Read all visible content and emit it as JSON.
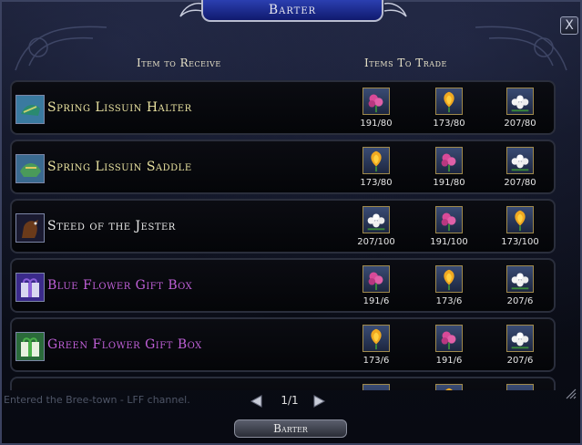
{
  "window": {
    "title": "Barter",
    "close_glyph": "X"
  },
  "columns": {
    "receive": "Item to Receive",
    "trade": "Items To Trade"
  },
  "rows": [
    {
      "name": "Spring Lissuin Halter",
      "name_color": "yellow",
      "icon": "halter-icon",
      "trade": [
        {
          "icon": "pink-flower-icon",
          "count": "191/80"
        },
        {
          "icon": "yellow-flower-icon",
          "count": "173/80"
        },
        {
          "icon": "white-flower-icon",
          "count": "207/80"
        }
      ]
    },
    {
      "name": "Spring Lissuin Saddle",
      "name_color": "yellow",
      "icon": "saddle-icon",
      "trade": [
        {
          "icon": "yellow-flower-icon",
          "count": "173/80"
        },
        {
          "icon": "pink-flower-icon",
          "count": "191/80"
        },
        {
          "icon": "white-flower-icon",
          "count": "207/80"
        }
      ]
    },
    {
      "name": "Steed of the Jester",
      "name_color": "white",
      "icon": "steed-icon",
      "trade": [
        {
          "icon": "white-flower-icon",
          "count": "207/100"
        },
        {
          "icon": "pink-flower-icon",
          "count": "191/100"
        },
        {
          "icon": "yellow-flower-icon",
          "count": "173/100"
        }
      ]
    },
    {
      "name": "Blue Flower Gift Box",
      "name_color": "purple",
      "icon": "blue-gift-box-icon",
      "trade": [
        {
          "icon": "pink-flower-icon",
          "count": "191/6"
        },
        {
          "icon": "yellow-flower-icon",
          "count": "173/6"
        },
        {
          "icon": "white-flower-icon",
          "count": "207/6"
        }
      ]
    },
    {
      "name": "Green Flower Gift Box",
      "name_color": "purple",
      "icon": "green-gift-box-icon",
      "trade": [
        {
          "icon": "yellow-flower-icon",
          "count": "173/6"
        },
        {
          "icon": "pink-flower-icon",
          "count": "191/6"
        },
        {
          "icon": "white-flower-icon",
          "count": "207/6"
        }
      ]
    },
    {
      "name": "",
      "name_color": "white",
      "icon": "",
      "trade": [
        {
          "icon": "pink-flower-icon",
          "count": ""
        },
        {
          "icon": "yellow-flower-icon",
          "count": ""
        },
        {
          "icon": "white-flower-icon",
          "count": ""
        }
      ]
    }
  ],
  "chat": {
    "line": "Entered the Bree-town - LFF channel."
  },
  "pager": {
    "text": "1/1"
  },
  "footer": {
    "barter_label": "Barter"
  },
  "colors": {
    "title_bar": "#1e2f9a",
    "name_yellow": "#e9e2a0",
    "name_purple": "#c060d8",
    "slot_border": "#a08a4c"
  }
}
